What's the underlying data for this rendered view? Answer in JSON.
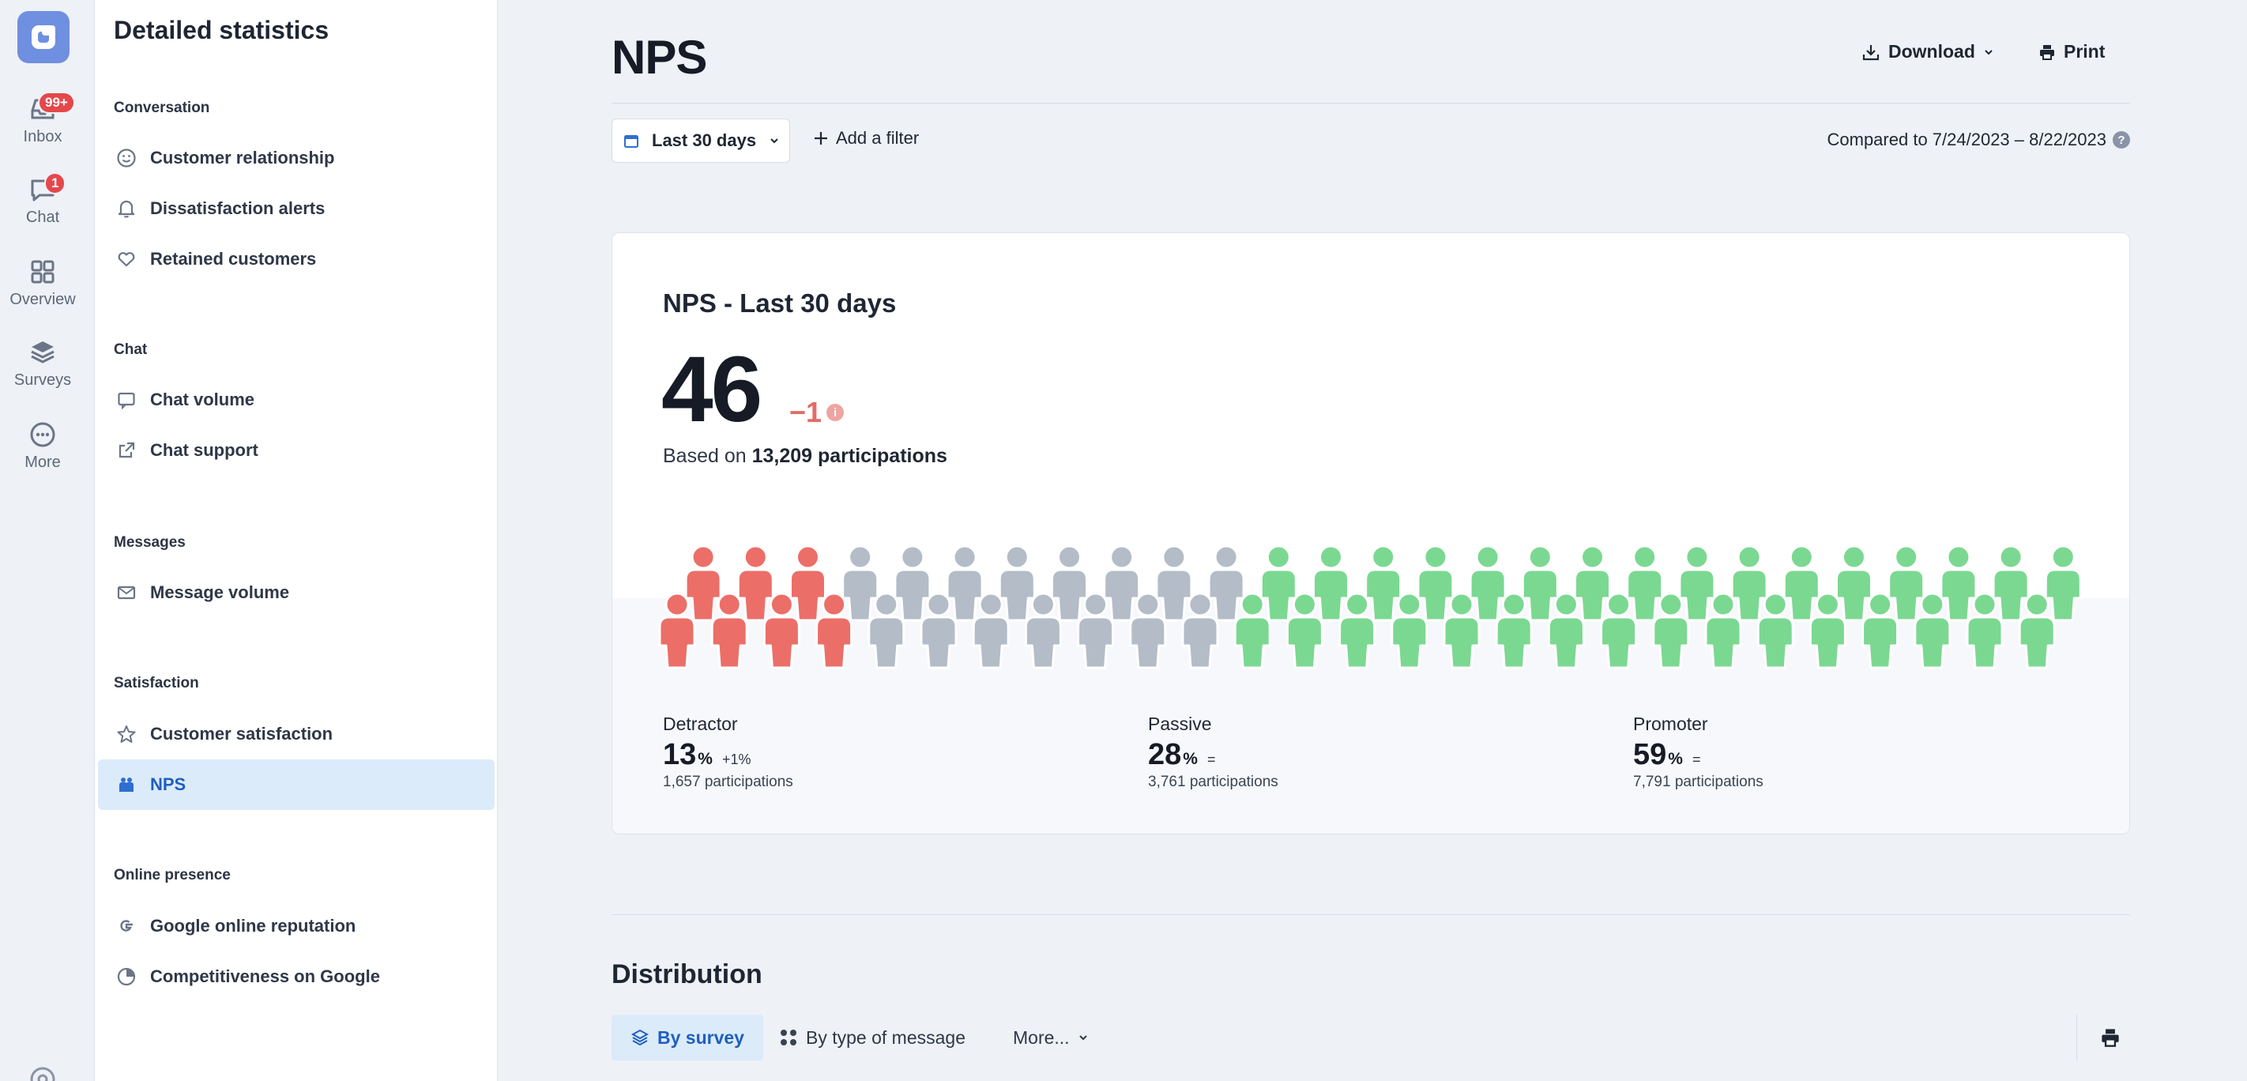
{
  "rail": {
    "items": [
      {
        "label": "Inbox",
        "badge": "99+",
        "icon": "inbox-icon"
      },
      {
        "label": "Chat",
        "badge": "1",
        "icon": "chat-icon"
      },
      {
        "label": "Overview",
        "icon": "grid-icon"
      },
      {
        "label": "Surveys",
        "icon": "layers-icon"
      },
      {
        "label": "More",
        "icon": "more-icon"
      }
    ]
  },
  "sidebar": {
    "title": "Detailed statistics",
    "sections": [
      {
        "title": "Conversation",
        "items": [
          "Customer relationship",
          "Dissatisfaction alerts",
          "Retained customers"
        ]
      },
      {
        "title": "Chat",
        "items": [
          "Chat volume",
          "Chat support"
        ]
      },
      {
        "title": "Messages",
        "items": [
          "Message volume"
        ]
      },
      {
        "title": "Satisfaction",
        "items": [
          "Customer satisfaction",
          "NPS"
        ]
      },
      {
        "title": "Online presence",
        "items": [
          "Google online reputation",
          "Competitiveness on Google"
        ]
      }
    ],
    "active_item": "NPS"
  },
  "header": {
    "title": "NPS",
    "download_label": "Download",
    "print_label": "Print"
  },
  "filters": {
    "date_range": "Last 30 days",
    "add_filter": "Add a filter",
    "compared": "Compared to 7/24/2023 – 8/22/2023"
  },
  "card": {
    "title": "NPS - Last 30 days",
    "score": "46",
    "delta": "−1",
    "based_prefix": "Based on",
    "based_value": "13,209 participations",
    "people_counts": {
      "detractor": 7,
      "passive": 15,
      "promoter": 32
    },
    "colors": {
      "detractor": "#ec6e68",
      "passive": "#b3bcc7",
      "promoter": "#7bd891"
    },
    "stats": [
      {
        "label": "Detractor",
        "value": "13",
        "unit": "%",
        "change": "+1%",
        "participations": "1,657 participations"
      },
      {
        "label": "Passive",
        "value": "28",
        "unit": "%",
        "change": "=",
        "participations": "3,761 participations"
      },
      {
        "label": "Promoter",
        "value": "59",
        "unit": "%",
        "change": "=",
        "participations": "7,791 participations"
      }
    ]
  },
  "distribution": {
    "title": "Distribution",
    "tabs": [
      "By survey",
      "By type of message",
      "More..."
    ]
  }
}
